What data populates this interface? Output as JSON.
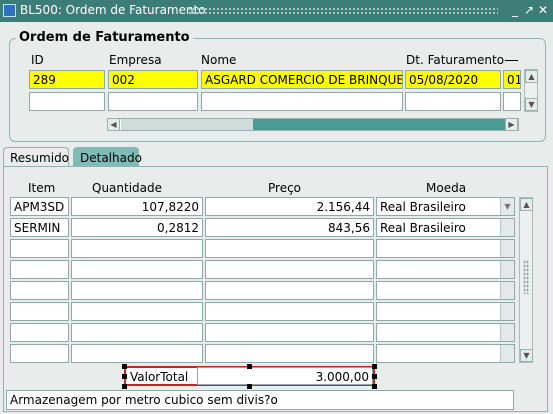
{
  "window": {
    "title": "BL500: Ordem de Faturamento"
  },
  "ordem": {
    "section_title": "Ordem de Faturamento",
    "headers": {
      "id": "ID",
      "empresa": "Empresa",
      "nome": "Nome",
      "dt_faturamento": "Dt. Faturamento"
    },
    "row1": {
      "id": "289",
      "empresa": "002",
      "nome": "ASGARD COMERCIO DE BRINQUE",
      "dt_faturamento": "05/08/2020",
      "extra": "01"
    }
  },
  "tabs": {
    "resumido": "Resumido",
    "detalhado": "Detalhado"
  },
  "table": {
    "headers": {
      "item": "Item",
      "quantidade": "Quantidade",
      "preco": "Preço",
      "moeda": "Moeda"
    },
    "rows": [
      {
        "item": "APM3SD",
        "quantidade": "107,8220",
        "preco": "2.156,44",
        "moeda": "Real Brasileiro"
      },
      {
        "item": "SERMIN",
        "quantidade": "0,2812",
        "preco": "843,56",
        "moeda": "Real Brasileiro"
      }
    ]
  },
  "total": {
    "label": "ValorTotal",
    "value": "3.000,00"
  },
  "status": {
    "message": "Armazenagem por metro cubico sem divis?o"
  },
  "colors": {
    "titlebar": "#3d7d78",
    "highlight": "#ffff00",
    "tab_inactive": "#7fbcb6",
    "selection_border": "#d02020"
  }
}
